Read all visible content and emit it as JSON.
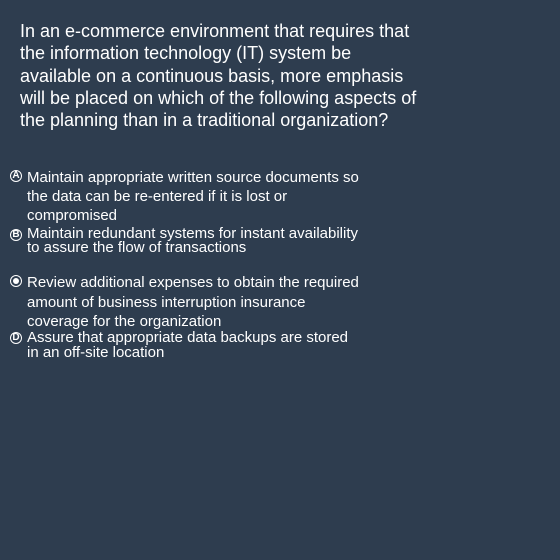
{
  "question": {
    "text": "In an e-commerce environment that requires that the information technology (IT) system be available on a continuous basis, more emphasis will be placed on which of the following aspects of the planning than in a traditional organization?"
  },
  "options": [
    {
      "letter": "A",
      "text": "Maintain appropriate written source documents so the data can be re-entered if it is lost or compromised",
      "selected": false
    },
    {
      "letter": "B",
      "text": "Maintain redundant systems for instant availability to assure the flow of transactions",
      "selected": false
    },
    {
      "letter": "C",
      "text": "Review additional expenses to obtain the required amount of business interruption insurance coverage for the organization",
      "selected": true
    },
    {
      "letter": "D",
      "text": "Assure that appropriate data backups are stored in an off-site location",
      "selected": false
    }
  ]
}
